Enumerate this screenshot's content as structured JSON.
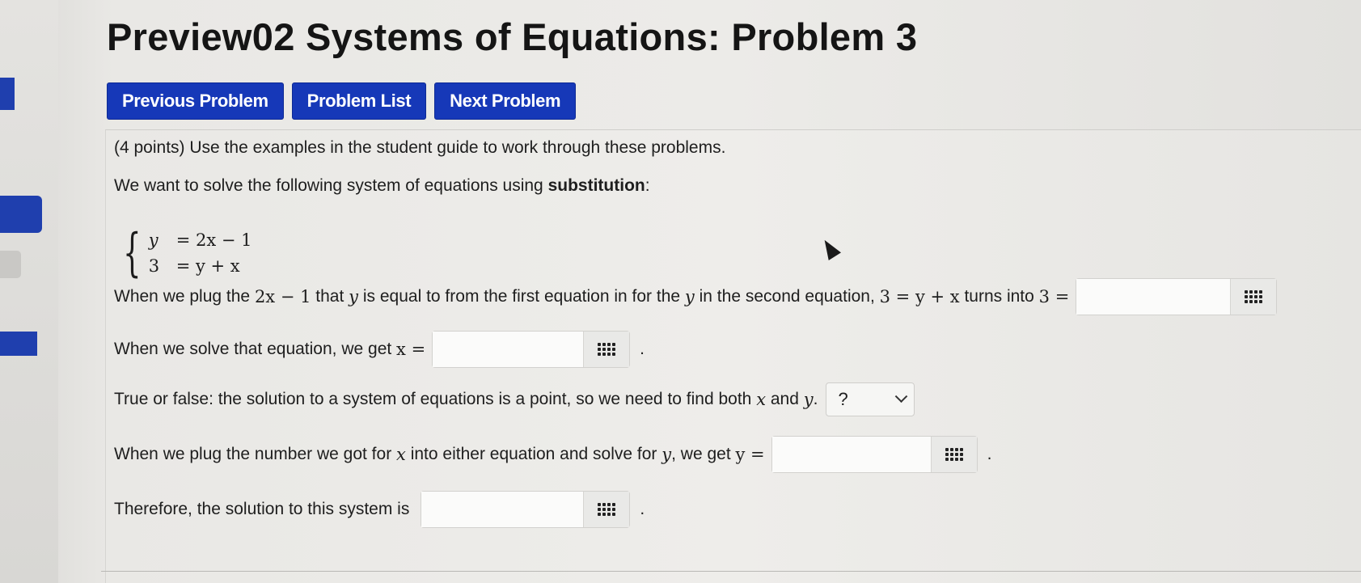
{
  "page_title": "Preview02 Systems of Equations: Problem 3",
  "nav": {
    "previous": "Previous Problem",
    "list": "Problem List",
    "next": "Next Problem"
  },
  "problem": {
    "intro": "(4 points) Use the examples in the student guide to work through these problems.",
    "statement_prefix": "We want to solve the following system of equations using ",
    "statement_bold": "substitution",
    "statement_suffix": ":",
    "system": {
      "row1_lhs": "y",
      "row1_rhs": "= 2x − 1",
      "row2_lhs": "3",
      "row2_rhs": "= y + x"
    },
    "q1": {
      "a": "When we plug the ",
      "expr1": "2x − 1",
      "b": " that ",
      "var1": "y",
      "c": " is equal to from the first equation in for the ",
      "var2": "y",
      "d": " in the second equation, ",
      "expr2": "3 = y + x",
      "e": " turns into ",
      "expr3": "3 ="
    },
    "q2": {
      "text": "When we solve that equation, we get ",
      "expr": "x =",
      "end": "."
    },
    "q3": {
      "text": "True or false: the solution to a system of equations is a point, so we need to find both ",
      "var1": "x",
      "and": " and ",
      "var2": "y",
      "end": ".",
      "selected": "?"
    },
    "q4": {
      "a": "When we plug the number we got for ",
      "var1": "x",
      "b": " into either equation and solve for ",
      "var2": "y",
      "c": ", we get ",
      "expr": "y =",
      "end": "."
    },
    "q5": {
      "text": "Therefore, the solution to this system is",
      "end": "."
    },
    "answers": [
      "",
      "",
      "",
      ""
    ]
  },
  "colors": {
    "button_blue": "#1638b8",
    "background": "#ecebe8"
  },
  "icons": [
    "keyboard-grid-icon",
    "chevron-down-icon",
    "mouse-cursor-icon"
  ]
}
